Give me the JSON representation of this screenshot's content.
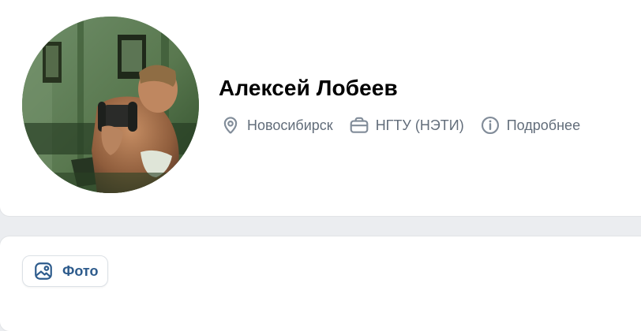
{
  "profile": {
    "name": "Алексей Лобеев",
    "city": "Новосибирск",
    "education": "НГТУ (НЭТИ)",
    "details_label": "Подробнее",
    "icons": {
      "avatar": "user-photo",
      "city": "location-pin-icon",
      "education": "briefcase-icon",
      "details": "info-icon"
    }
  },
  "tabs": {
    "photo_label": "Фото",
    "photo_icon": "image-icon"
  },
  "colors": {
    "page_background": "#ebedf0",
    "card_background": "#ffffff",
    "name_text": "#000000",
    "secondary_text": "#626d7a",
    "accent_text": "#2d5b8c"
  }
}
